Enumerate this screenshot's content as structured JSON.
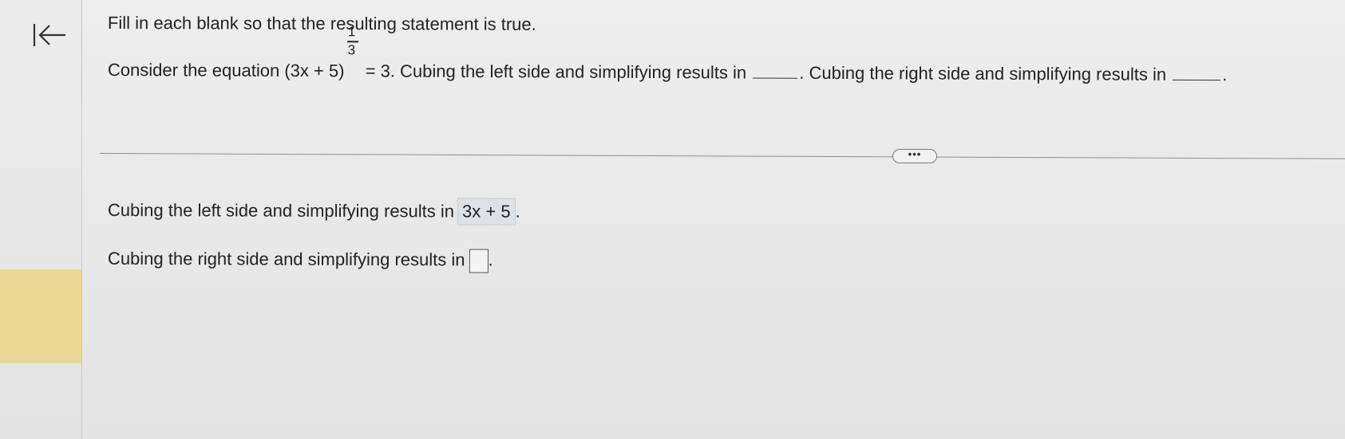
{
  "nav": {
    "back_icon": "collapse-left-arrow-icon"
  },
  "question": {
    "instruction": "Fill in each blank so that the resulting statement is true.",
    "prefix": "Consider the equation (3x + 5)",
    "exponent_numerator": "1",
    "exponent_denominator": "3",
    "after_equation": "= 3. Cubing the left side and simplifying results in",
    "middle": ". Cubing the right side and simplifying results in",
    "end": "."
  },
  "divider": {
    "more_label": "•••"
  },
  "answers": {
    "left_label": "Cubing the left side and simplifying results in",
    "left_value": "3x + 5",
    "left_end": ".",
    "right_label": "Cubing the right side and simplifying results in",
    "right_value": "",
    "right_end": "."
  },
  "colors": {
    "accent_block": "#ecd895",
    "filled_answer_bg": "#dde2e7"
  }
}
